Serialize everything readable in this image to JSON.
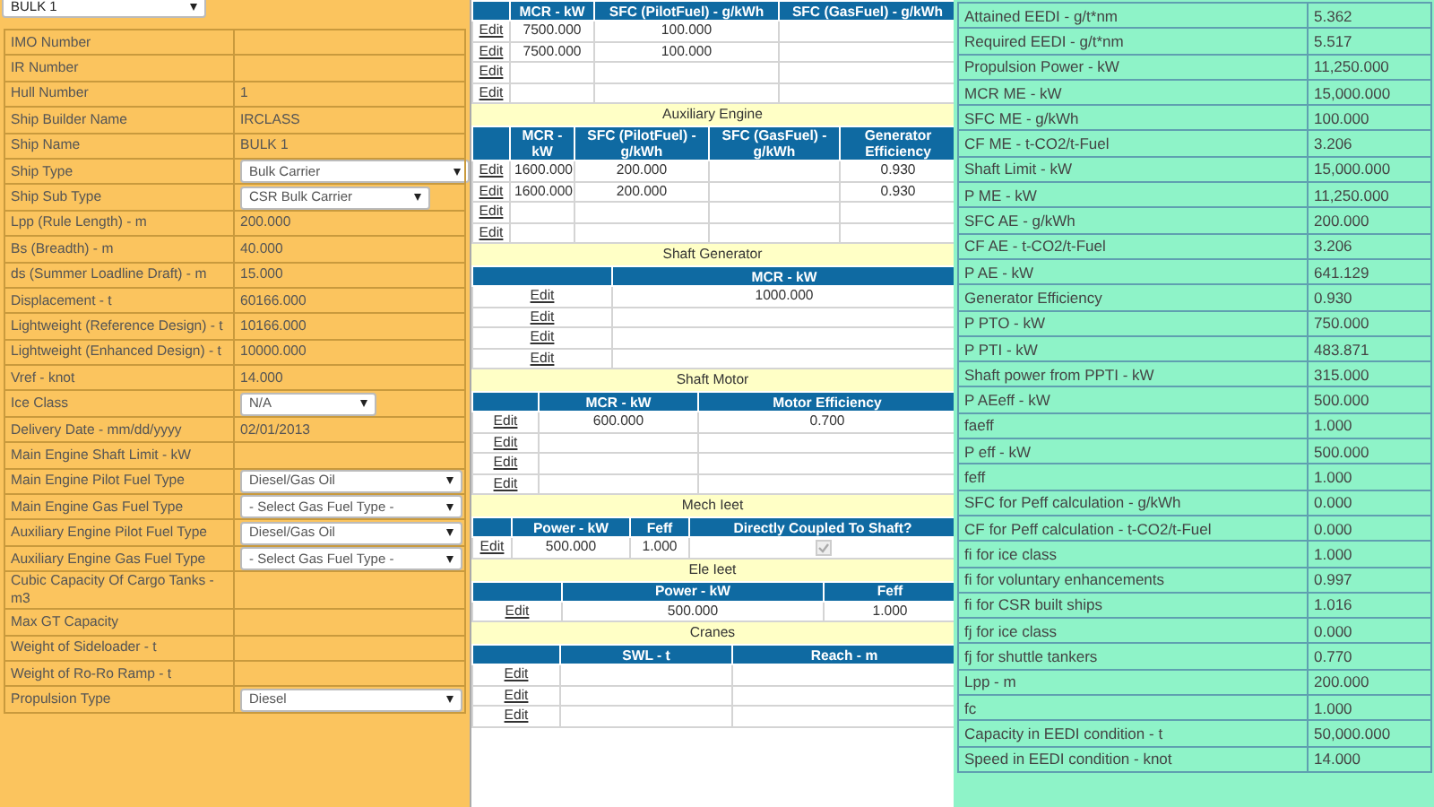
{
  "vessel_select": {
    "value": "BULK 1"
  },
  "ship_details": [
    {
      "label": "IMO Number",
      "kind": "text"
    },
    {
      "label": "IR Number",
      "kind": "text"
    },
    {
      "label": "Hull Number",
      "kind": "text",
      "value": "1"
    },
    {
      "label": "Ship Builder Name",
      "kind": "text",
      "value": "IRCLASS"
    },
    {
      "label": "Ship Name",
      "kind": "text",
      "value": "BULK 1"
    },
    {
      "label": "Ship Type",
      "kind": "select",
      "value": "Bulk Carrier"
    },
    {
      "label": "Ship Sub Type",
      "kind": "select",
      "value": "CSR Bulk Carrier"
    },
    {
      "label": "Lpp (Rule Length) - m",
      "kind": "text",
      "value": "200.000"
    },
    {
      "label": "Bs (Breadth) - m",
      "kind": "text",
      "value": "40.000"
    },
    {
      "label": "ds (Summer Loadline Draft) - m",
      "kind": "text",
      "value": "15.000"
    },
    {
      "label": "Displacement - t",
      "kind": "text",
      "value": "60166.000"
    },
    {
      "label": "Lightweight (Reference Design) - t",
      "kind": "text",
      "value": "10166.000"
    },
    {
      "label": "Lightweight (Enhanced Design) - t",
      "kind": "text",
      "value": "10000.000"
    },
    {
      "label": "Vref - knot",
      "kind": "text",
      "value": "14.000"
    },
    {
      "label": "Ice Class",
      "kind": "select",
      "value": "N/A"
    },
    {
      "label": "Delivery Date - mm/dd/yyyy",
      "kind": "text",
      "value": "02/01/2013"
    },
    {
      "label": "Main Engine Shaft Limit - kW",
      "kind": "text"
    },
    {
      "label": "Main Engine Pilot Fuel Type",
      "kind": "select",
      "value": "Diesel/Gas Oil"
    },
    {
      "label": "Main Engine Gas Fuel Type",
      "kind": "select",
      "value": "- Select Gas Fuel Type -"
    },
    {
      "label": "Auxiliary Engine Pilot Fuel Type",
      "kind": "select",
      "value": "Diesel/Gas Oil"
    },
    {
      "label": "Auxiliary Engine Gas Fuel Type",
      "kind": "select",
      "value": "- Select Gas Fuel Type -"
    },
    {
      "label": "Cubic Capacity Of Cargo Tanks - m3",
      "kind": "text"
    },
    {
      "label": "Max GT Capacity",
      "kind": "text"
    },
    {
      "label": "Weight of Sideloader - t",
      "kind": "text"
    },
    {
      "label": "Weight of Ro-Ro Ramp - t",
      "kind": "text"
    },
    {
      "label": "Propulsion Type",
      "kind": "select",
      "value": "Diesel"
    }
  ],
  "equipment": [
    {
      "columns": [
        "MCR - kW",
        "SFC (PilotFuel) - g/kWh",
        "SFC (GasFuel) - g/kWh"
      ],
      "rows": [
        {
          "action": "Edit",
          "cells": [
            "7500.000",
            "100.000",
            null
          ]
        },
        {
          "action": "Edit",
          "cells": [
            "7500.000",
            "100.000",
            null
          ]
        },
        {
          "action": "Edit",
          "cells": [
            null,
            null,
            null
          ]
        },
        {
          "action": "Edit",
          "cells": [
            null,
            null,
            null
          ]
        }
      ]
    },
    {
      "title": "Auxiliary Engine",
      "columns": [
        "MCR - kW",
        "SFC (PilotFuel) - g/kWh",
        "SFC (GasFuel) - g/kWh",
        "Generator Efficiency"
      ],
      "rows": [
        {
          "action": "Edit",
          "cells": [
            "1600.000",
            "200.000",
            null,
            "0.930"
          ]
        },
        {
          "action": "Edit",
          "cells": [
            "1600.000",
            "200.000",
            null,
            "0.930"
          ]
        },
        {
          "action": "Edit",
          "cells": [
            null,
            null,
            null,
            null
          ]
        },
        {
          "action": "Edit",
          "cells": [
            null,
            null,
            null,
            null
          ]
        }
      ]
    },
    {
      "title": "Shaft Generator",
      "columns": [
        "MCR - kW"
      ],
      "rows": [
        {
          "action": "Edit",
          "cells": [
            "1000.000"
          ]
        },
        {
          "action": "Edit",
          "cells": [
            null
          ]
        },
        {
          "action": "Edit",
          "cells": [
            null
          ]
        },
        {
          "action": "Edit",
          "cells": [
            null
          ]
        }
      ]
    },
    {
      "title": "Shaft Motor",
      "columns": [
        "MCR - kW",
        "Motor Efficiency"
      ],
      "rows": [
        {
          "action": "Edit",
          "cells": [
            "600.000",
            "0.700"
          ]
        },
        {
          "action": "Edit",
          "cells": [
            null,
            null
          ]
        },
        {
          "action": "Edit",
          "cells": [
            null,
            null
          ]
        },
        {
          "action": "Edit",
          "cells": [
            null,
            null
          ]
        }
      ]
    },
    {
      "title": "Mech Ieet",
      "columns": [
        "Power - kW",
        "Feff",
        "Directly Coupled To Shaft?"
      ],
      "rows": [
        {
          "action": "Edit",
          "cells": [
            "500.000",
            "1.000",
            {
              "kind": "checkbox",
              "checked": true,
              "disabled": true
            }
          ]
        }
      ]
    },
    {
      "title": "Ele Ieet",
      "columns": [
        "Power - kW",
        "Feff"
      ],
      "rows": [
        {
          "action": "Edit",
          "cells": [
            "500.000",
            "1.000"
          ]
        }
      ]
    },
    {
      "title": "Cranes",
      "columns": [
        "SWL - t",
        "Reach - m"
      ],
      "rows": [
        {
          "action": "Edit",
          "cells": [
            null,
            null
          ]
        },
        {
          "action": "Edit",
          "cells": [
            null,
            null
          ]
        },
        {
          "action": "Edit",
          "cells": [
            null,
            null
          ]
        }
      ]
    }
  ],
  "results": [
    {
      "label": "Attained EEDI - g/t*nm",
      "value": "5.362"
    },
    {
      "label": "Required EEDI - g/t*nm",
      "value": "5.517"
    },
    {
      "label": "Propulsion Power - kW",
      "value": "11,250.000"
    },
    {
      "label": "MCR ME - kW",
      "value": "15,000.000"
    },
    {
      "label": "SFC ME - g/kWh",
      "value": "100.000"
    },
    {
      "label": "CF ME - t-CO2/t-Fuel",
      "value": "3.206"
    },
    {
      "label": "Shaft Limit - kW",
      "value": "15,000.000"
    },
    {
      "label": "P ME - kW",
      "value": "11,250.000"
    },
    {
      "label": "SFC AE - g/kWh",
      "value": "200.000"
    },
    {
      "label": "CF AE - t-CO2/t-Fuel",
      "value": "3.206"
    },
    {
      "label": "P AE - kW",
      "value": "641.129"
    },
    {
      "label": "Generator Efficiency",
      "value": "0.930"
    },
    {
      "label": "P PTO - kW",
      "value": "750.000"
    },
    {
      "label": "P PTI - kW",
      "value": "483.871"
    },
    {
      "label": "Shaft power from PPTI - kW",
      "value": "315.000"
    },
    {
      "label": "P AEeff - kW",
      "value": "500.000"
    },
    {
      "label": "faeff",
      "value": "1.000"
    },
    {
      "label": "P eff - kW",
      "value": "500.000"
    },
    {
      "label": "feff",
      "value": "1.000"
    },
    {
      "label": "SFC for Peff calculation - g/kWh",
      "value": "0.000"
    },
    {
      "label": "CF for Peff calculation - t-CO2/t-Fuel",
      "value": "0.000"
    },
    {
      "label": "fi for ice class",
      "value": "1.000"
    },
    {
      "label": "fi for voluntary enhancements",
      "value": "0.997"
    },
    {
      "label": "fi for CSR built ships",
      "value": "1.016"
    },
    {
      "label": "fj for ice class",
      "value": "0.000"
    },
    {
      "label": "fj for shuttle tankers",
      "value": "0.770"
    },
    {
      "label": "Lpp - m",
      "value": "200.000"
    },
    {
      "label": "fc",
      "value": "1.000"
    },
    {
      "label": "Capacity in EEDI condition - t",
      "value": "50,000.000"
    },
    {
      "label": "Speed in EEDI condition - knot",
      "value": "14.000"
    }
  ]
}
